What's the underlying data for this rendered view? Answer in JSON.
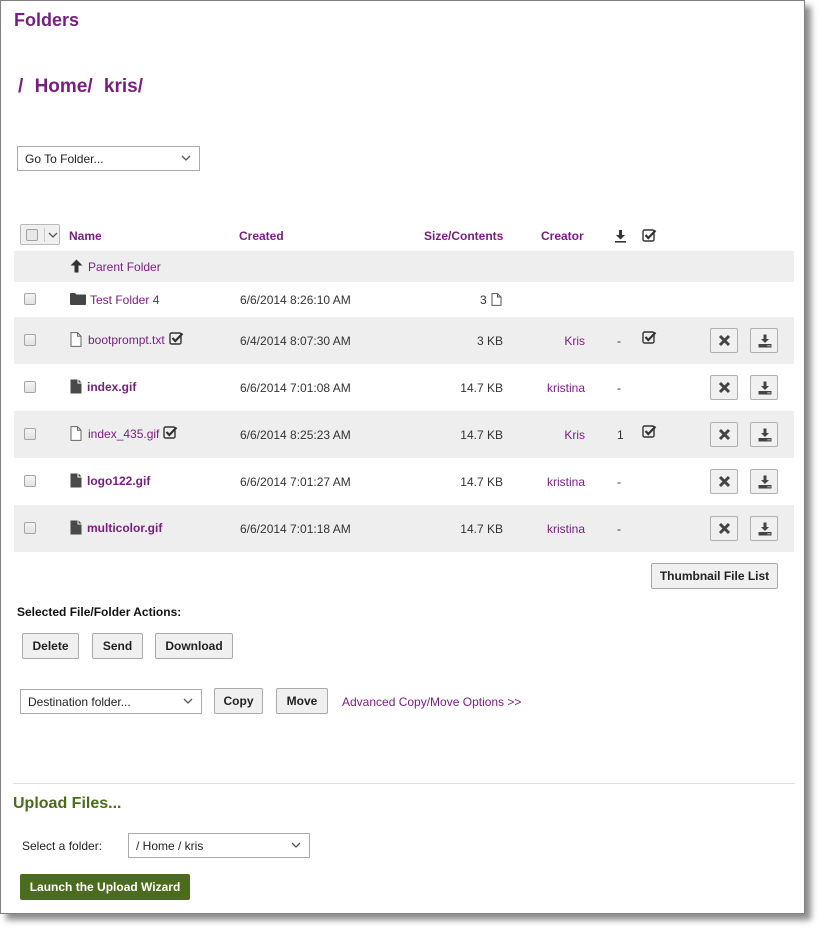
{
  "page": {
    "title": "Folders",
    "breadcrumb": [
      "/",
      "Home/",
      "kris/"
    ]
  },
  "goto_folder": {
    "selected": "Go To Folder..."
  },
  "table": {
    "headers": {
      "name": "Name",
      "created": "Created",
      "size": "Size/Contents",
      "creator": "Creator",
      "downloads_icon": "download-icon",
      "checkout_icon": "checked-box-icon"
    },
    "parent_folder": {
      "label": "Parent Folder",
      "icon": "arrow-up-icon"
    },
    "folder_row": {
      "name": "Test Folder 4",
      "icon": "folder-icon",
      "created": "6/6/2014 8:26:10 AM",
      "contents_count": "3",
      "contents_icon": "file-outline-icon"
    },
    "files": [
      {
        "name": "bootprompt.txt",
        "icon": "file-outline-icon",
        "bold": false,
        "checked_out": true,
        "created": "6/4/2014 8:07:30 AM",
        "size": "3 KB",
        "creator": "Kris",
        "downloads": "-",
        "checkout": true
      },
      {
        "name": "index.gif",
        "icon": "file-solid-icon",
        "bold": true,
        "checked_out": false,
        "created": "6/6/2014 7:01:08 AM",
        "size": "14.7 KB",
        "creator": "kristina",
        "downloads": "-",
        "checkout": false
      },
      {
        "name": "index_435.gif",
        "icon": "file-outline-icon",
        "bold": false,
        "checked_out": true,
        "created": "6/6/2014 8:25:23 AM",
        "size": "14.7 KB",
        "creator": "Kris",
        "downloads": "1",
        "checkout": true
      },
      {
        "name": "logo122.gif",
        "icon": "file-solid-icon",
        "bold": true,
        "checked_out": false,
        "created": "6/6/2014 7:01:27 AM",
        "size": "14.7 KB",
        "creator": "kristina",
        "downloads": "-",
        "checkout": false
      },
      {
        "name": "multicolor.gif",
        "icon": "file-solid-icon",
        "bold": true,
        "checked_out": false,
        "created": "6/6/2014 7:01:18 AM",
        "size": "14.7 KB",
        "creator": "kristina",
        "downloads": "-",
        "checkout": false
      }
    ]
  },
  "thumbnail_button": "Thumbnail File List",
  "actions": {
    "label": "Selected File/Folder Actions:",
    "delete": "Delete",
    "send": "Send",
    "download": "Download",
    "destination": "Destination folder...",
    "copy": "Copy",
    "move": "Move",
    "advanced": "Advanced Copy/Move Options >>"
  },
  "upload": {
    "title": "Upload Files...",
    "select_label": "Select a folder:",
    "selected_folder": "/ Home / kris",
    "launch": "Launch the Upload Wizard"
  },
  "colors": {
    "accent_purple": "#76207e",
    "upload_green": "#4b6b1e",
    "row_shade": "#eeeeee"
  }
}
